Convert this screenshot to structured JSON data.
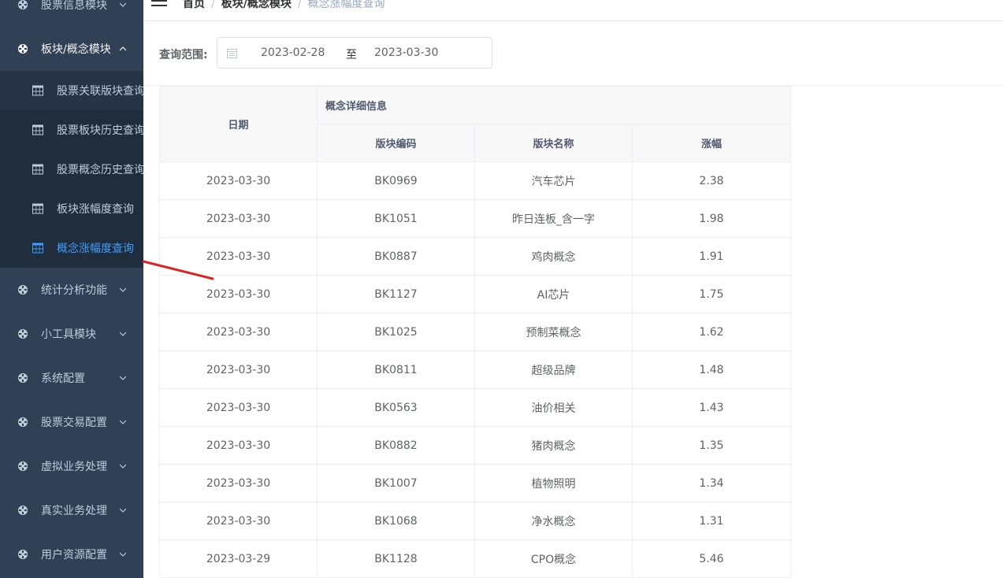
{
  "sidebar": {
    "top_item": {
      "label": "股票信息模块"
    },
    "open_group": {
      "label": "板块/概念模块"
    },
    "sub_items": [
      {
        "label": "股票关联版块查询"
      },
      {
        "label": "股票板块历史查询"
      },
      {
        "label": "股票概念历史查询"
      },
      {
        "label": "板块涨幅度查询"
      },
      {
        "label": "概念涨幅度查询"
      }
    ],
    "groups": [
      {
        "label": "统计分析功能"
      },
      {
        "label": "小工具模块"
      },
      {
        "label": "系统配置"
      },
      {
        "label": "股票交易配置"
      },
      {
        "label": "虚拟业务处理"
      },
      {
        "label": "真实业务处理"
      },
      {
        "label": "用户资源配置"
      }
    ],
    "colors": {
      "bg": "#304156",
      "sub_bg": "#1f2d3d",
      "active": "#409eff"
    }
  },
  "breadcrumb": {
    "items": [
      "首页",
      "板块/概念模块"
    ],
    "current": "概念涨幅度查询"
  },
  "filter": {
    "label": "查询范围:",
    "start_date": "2023-02-28",
    "separator": "至",
    "end_date": "2023-03-30"
  },
  "table": {
    "header_date": "日期",
    "header_group": "概念详细信息",
    "header_code": "版块编码",
    "header_name": "版块名称",
    "header_change": "涨幅",
    "rows": [
      {
        "date": "2023-03-30",
        "code": "BK0969",
        "name": "汽车芯片",
        "change": "2.38"
      },
      {
        "date": "2023-03-30",
        "code": "BK1051",
        "name": "昨日连板_含一字",
        "change": "1.98"
      },
      {
        "date": "2023-03-30",
        "code": "BK0887",
        "name": "鸡肉概念",
        "change": "1.91"
      },
      {
        "date": "2023-03-30",
        "code": "BK1127",
        "name": "AI芯片",
        "change": "1.75"
      },
      {
        "date": "2023-03-30",
        "code": "BK1025",
        "name": "预制菜概念",
        "change": "1.62"
      },
      {
        "date": "2023-03-30",
        "code": "BK0811",
        "name": "超级品牌",
        "change": "1.48"
      },
      {
        "date": "2023-03-30",
        "code": "BK0563",
        "name": "油价相关",
        "change": "1.43"
      },
      {
        "date": "2023-03-30",
        "code": "BK0882",
        "name": "猪肉概念",
        "change": "1.35"
      },
      {
        "date": "2023-03-30",
        "code": "BK1007",
        "name": "植物照明",
        "change": "1.34"
      },
      {
        "date": "2023-03-30",
        "code": "BK1068",
        "name": "净水概念",
        "change": "1.31"
      },
      {
        "date": "2023-03-29",
        "code": "BK1128",
        "name": "CPO概念",
        "change": "5.46"
      }
    ]
  },
  "icons": {
    "menu_group": "gear-icon",
    "sub_item": "table-icon",
    "arrow": "chevron-icon",
    "date": "calendar-icon",
    "toggle": "hamburger-icon"
  }
}
